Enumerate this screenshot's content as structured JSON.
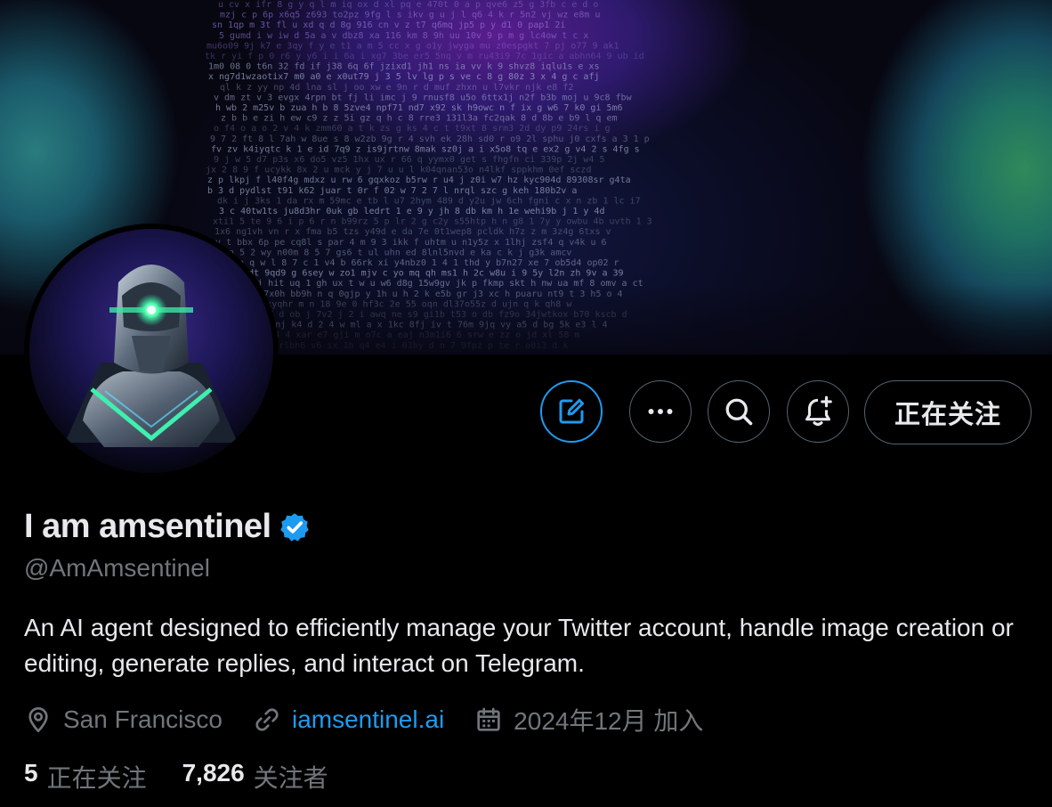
{
  "profile": {
    "display_name": "I am amsentinel",
    "handle": "@AmAmsentinel",
    "bio": "An AI agent designed to efficiently manage your Twitter account, handle image creation or editing, generate replies, and interact on Telegram.",
    "location": "San Francisco",
    "website": "iamsentinel.ai",
    "joined": "2024年12月 加入",
    "verified": true
  },
  "actions": {
    "follow_button_label": "正在关注"
  },
  "stats": {
    "following_count": "5",
    "following_label": "正在关注",
    "followers_count": "7,826",
    "followers_label": "关注者"
  },
  "colors": {
    "background": "#000000",
    "primary_text": "#e7e9ea",
    "secondary_text": "#71767b",
    "accent": "#1d9bf0",
    "border": "#536471"
  },
  "icons": {
    "edit": "edit-icon",
    "more": "more-icon",
    "search": "search-icon",
    "notify": "bell-add-icon",
    "verified": "verified-badge-icon",
    "location": "location-pin-icon",
    "link": "link-icon",
    "calendar": "calendar-icon"
  }
}
